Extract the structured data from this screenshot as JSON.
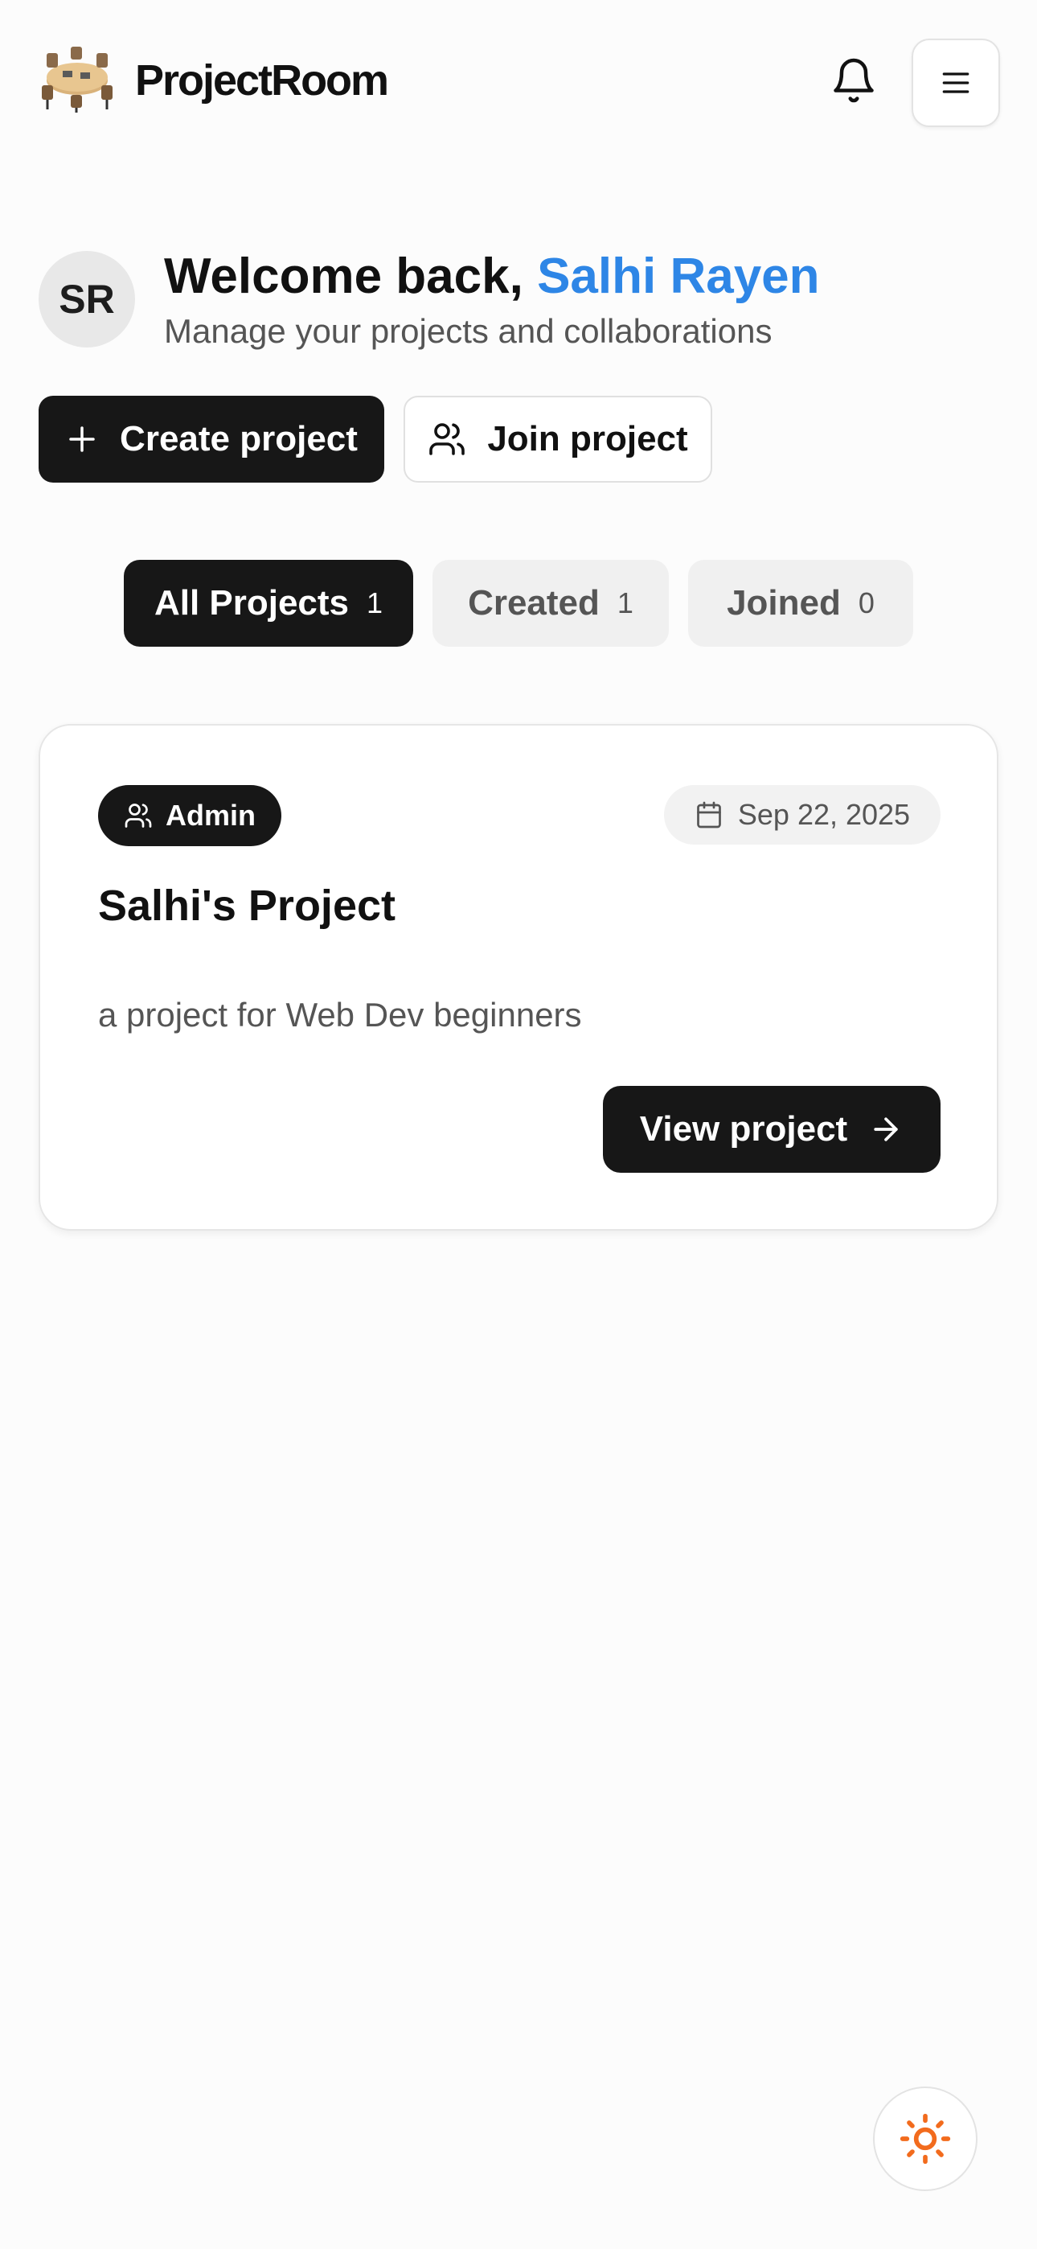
{
  "header": {
    "app_name": "ProjectRoom",
    "logo_icon": "meeting-room-icon",
    "notifications_icon": "bell-icon",
    "menu_icon": "hamburger-menu-icon"
  },
  "user": {
    "initials": "SR",
    "welcome_prefix": "Welcome back, ",
    "name": "Salhi Rayen",
    "subtitle": "Manage your projects and collaborations"
  },
  "actions": {
    "create_label": "Create project",
    "create_icon": "plus-icon",
    "join_label": "Join project",
    "join_icon": "users-icon"
  },
  "tabs": [
    {
      "label": "All Projects",
      "count": "1",
      "active": true
    },
    {
      "label": "Created",
      "count": "1",
      "active": false
    },
    {
      "label": "Joined",
      "count": "0",
      "active": false
    }
  ],
  "projects": [
    {
      "role": "Admin",
      "role_icon": "users-icon",
      "date": "Sep 22, 2025",
      "date_icon": "calendar-icon",
      "title": "Salhi's Project",
      "description": "a project for Web Dev beginners",
      "view_label": "View project",
      "view_icon": "arrow-right-icon"
    }
  ],
  "theme_toggle": {
    "icon": "sun-icon"
  },
  "colors": {
    "accent": "#2e86e6",
    "primary_button": "#171717",
    "sun": "#f26b1d"
  }
}
